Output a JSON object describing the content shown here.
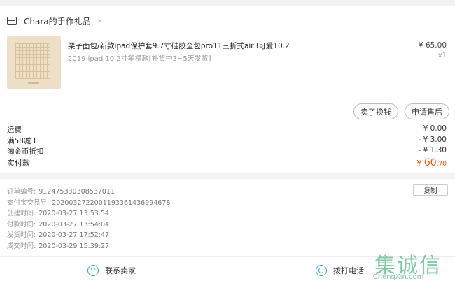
{
  "shop": {
    "name": "Chara的手作礼品",
    "chevron": "›"
  },
  "product": {
    "title": "栗子面包/新款ipad保护套9.7寸硅胶全包pro11三折式air3可爱10.2",
    "sku": "2019 ipad 10.2寸笔槽款[补货中3~5天发货]",
    "price": "¥ 65.00",
    "qty": "x1"
  },
  "actions": {
    "exchange": "卖了换钱",
    "aftersale": "申请售后"
  },
  "price_summary": {
    "shipping_label": "运费",
    "shipping_value": "¥ 0.00",
    "coupon_label": "满58减3",
    "coupon_value": "- ¥ 3.00",
    "taojin_label": "淘金币抵扣",
    "taojin_value": "- ¥ 1.30",
    "paid_label": "实付款",
    "paid_currency": "¥ ",
    "paid_int": "60",
    "paid_dec": ".70"
  },
  "order_info": {
    "order_no_label": "订单编号:",
    "order_no": "912475330308537011",
    "alipay_label": "支付宝交易号:",
    "alipay_no": "2020032722001193361436994678",
    "created_label": "创建时间:",
    "created": "2020-03-27 13:53:54",
    "paid_label": "付款时间:",
    "paid": "2020-03-27 13:54:04",
    "shipped_label": "发货时间:",
    "shipped": "2020-03-27 17:52:47",
    "done_label": "成交时间:",
    "done": "2020-03-29 15:39:27",
    "copy_label": "复制"
  },
  "bottom": {
    "contact": "联系卖家",
    "call": "拨打电话"
  },
  "watermark": {
    "chars": "集诚信",
    "url": "JiChengXin.com"
  },
  "colors": {
    "accent": "#ff5000",
    "icon": "#2fa5dd"
  }
}
